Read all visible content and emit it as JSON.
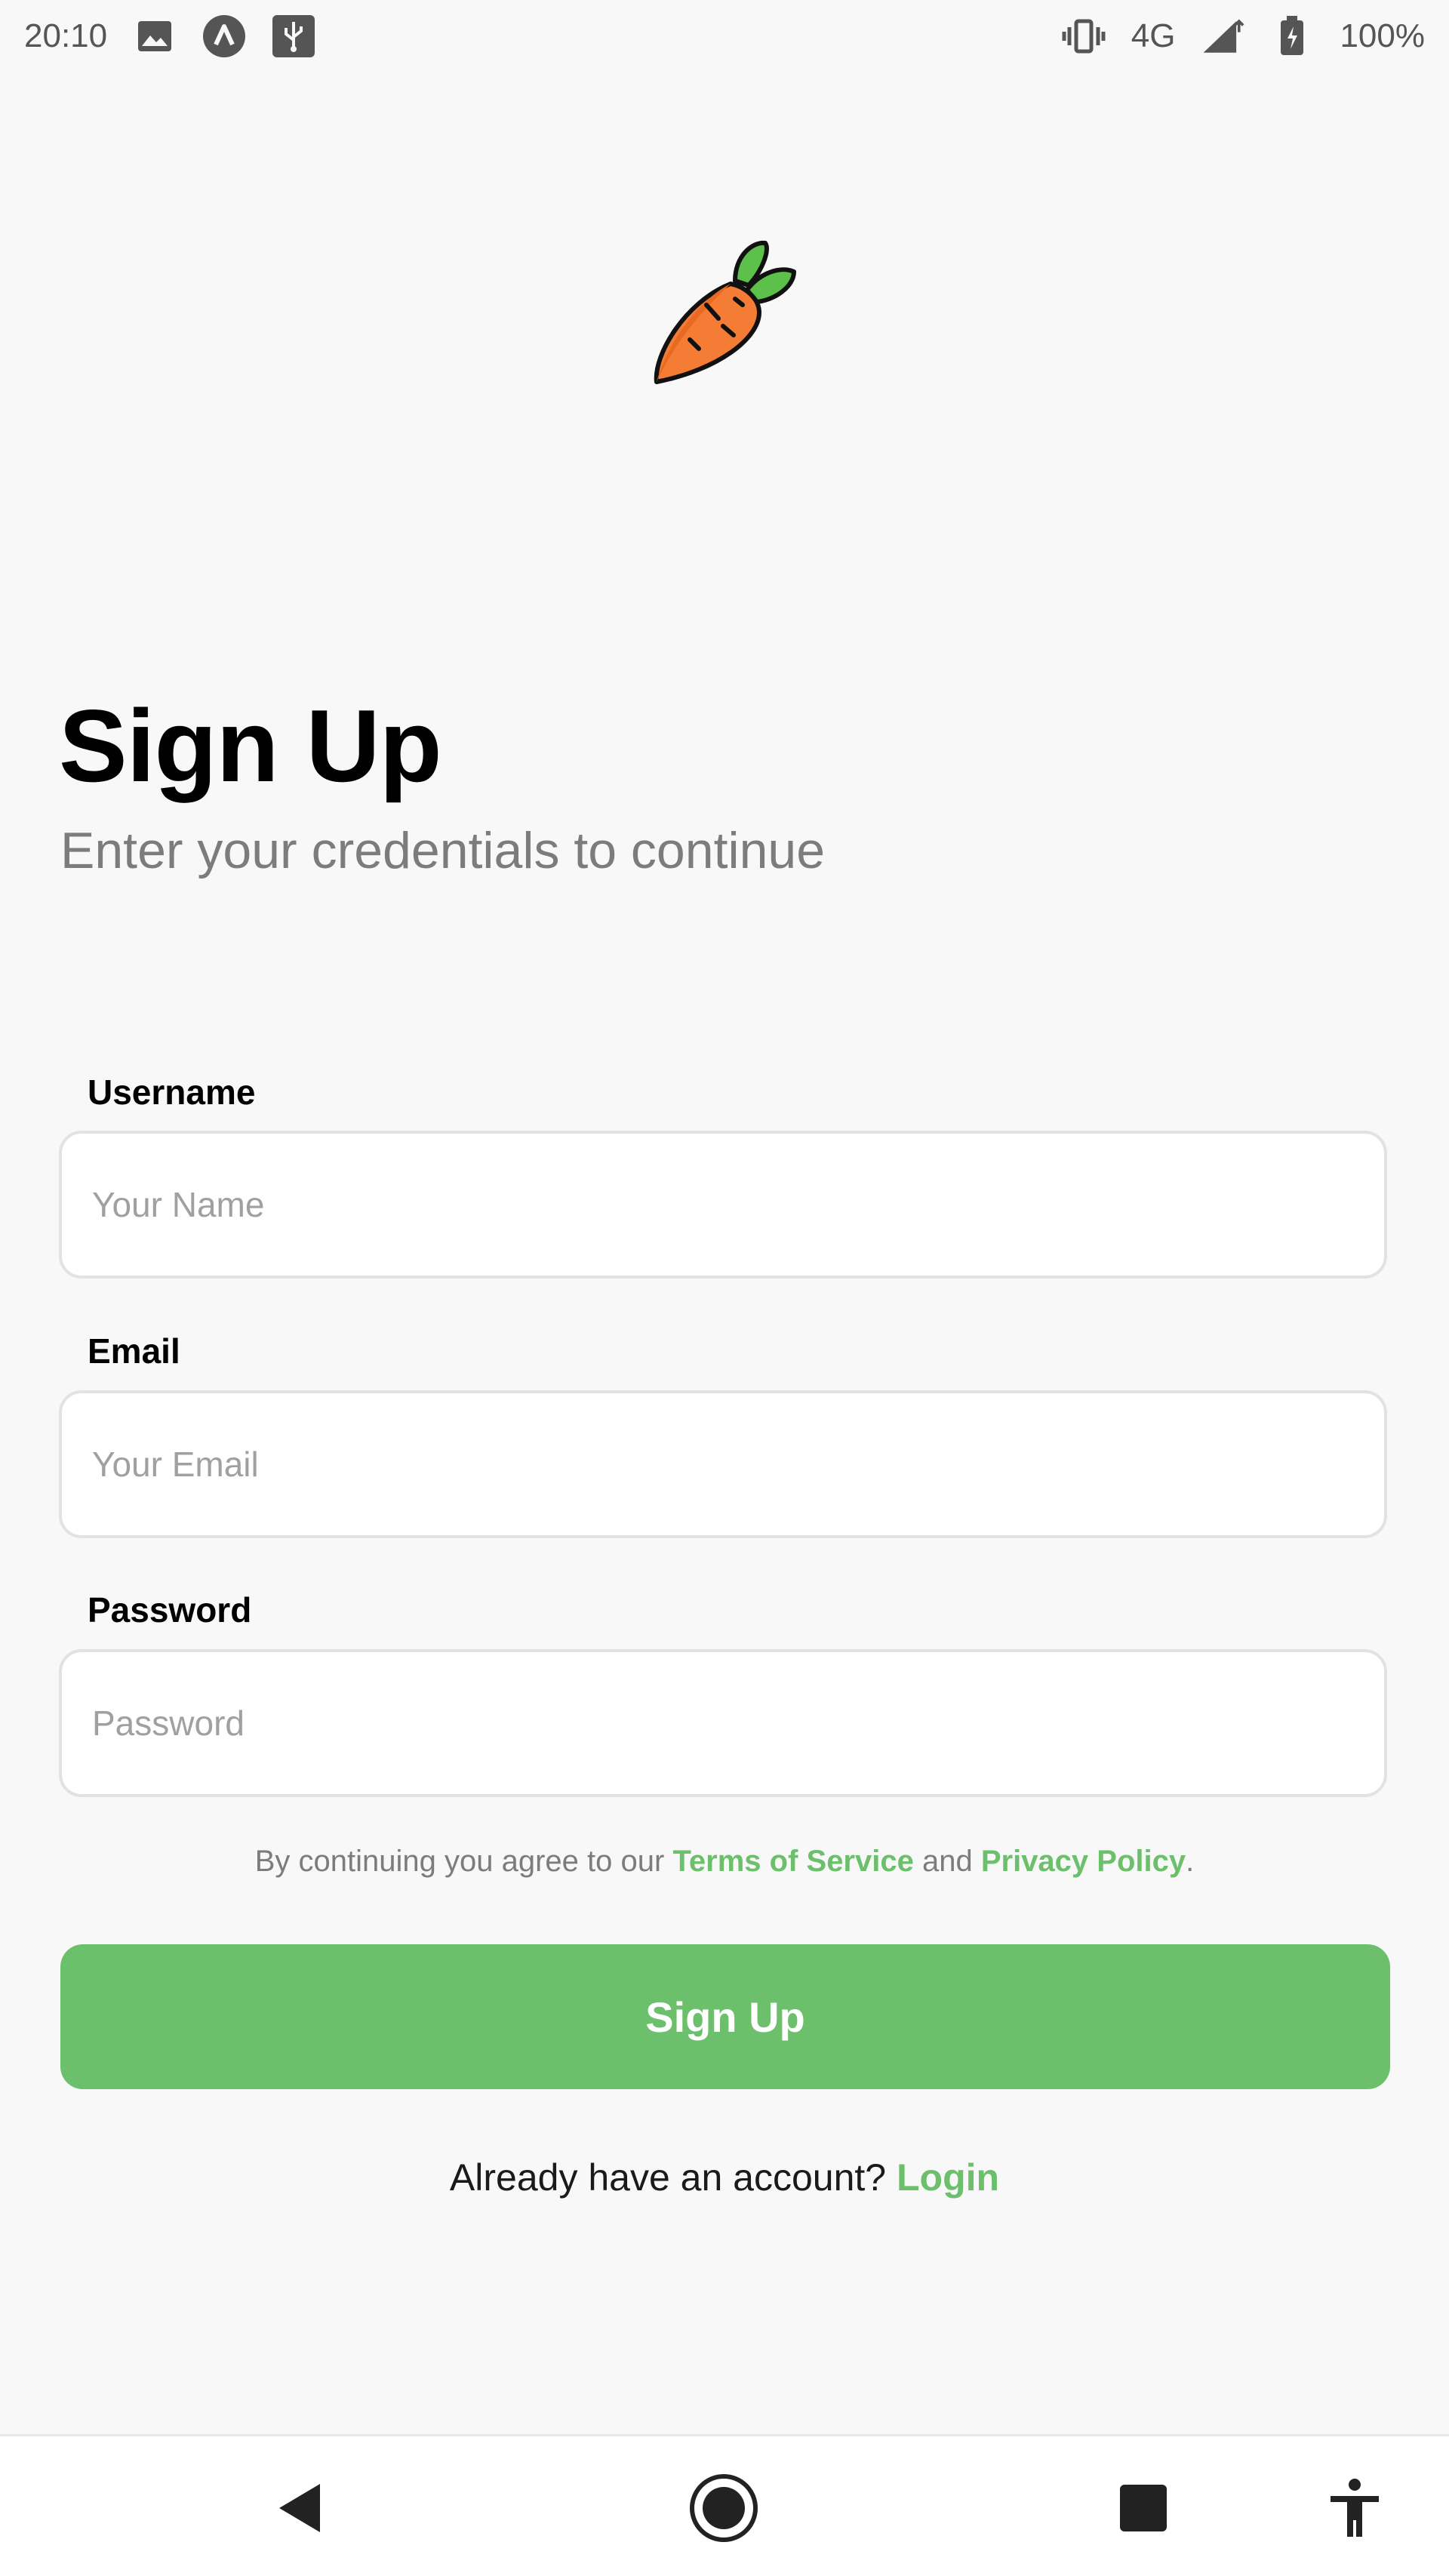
{
  "status_bar": {
    "time": "20:10",
    "left_icons": [
      "image-icon",
      "a-logo-icon",
      "usb-icon"
    ],
    "network": "4G",
    "battery": "100%",
    "right_icons": [
      "vibrate-icon",
      "signal-icon",
      "battery-icon"
    ]
  },
  "logo": {
    "icon": "carrot-icon"
  },
  "header": {
    "title": "Sign Up",
    "subtitle": "Enter your credentials to continue"
  },
  "form": {
    "username": {
      "label": "Username",
      "placeholder": "Your Name",
      "value": ""
    },
    "email": {
      "label": "Email",
      "placeholder": "Your Email",
      "value": ""
    },
    "password": {
      "label": "Password",
      "placeholder": "Password",
      "value": ""
    }
  },
  "agreement": {
    "prefix": "By continuing you agree to our ",
    "terms": "Terms of Service",
    "middle": " and ",
    "privacy": "Privacy Policy",
    "suffix": "."
  },
  "signup_button": "Sign Up",
  "login_prompt": {
    "text": "Already have an account? ",
    "link": "Login"
  },
  "colors": {
    "accent": "#6cc06c",
    "background": "#f8f8f8",
    "carrot": "#f47c34",
    "leaf": "#5cc04a"
  },
  "nav_bar": {
    "icons": [
      "back-icon",
      "home-icon",
      "recents-icon",
      "accessibility-icon"
    ]
  }
}
